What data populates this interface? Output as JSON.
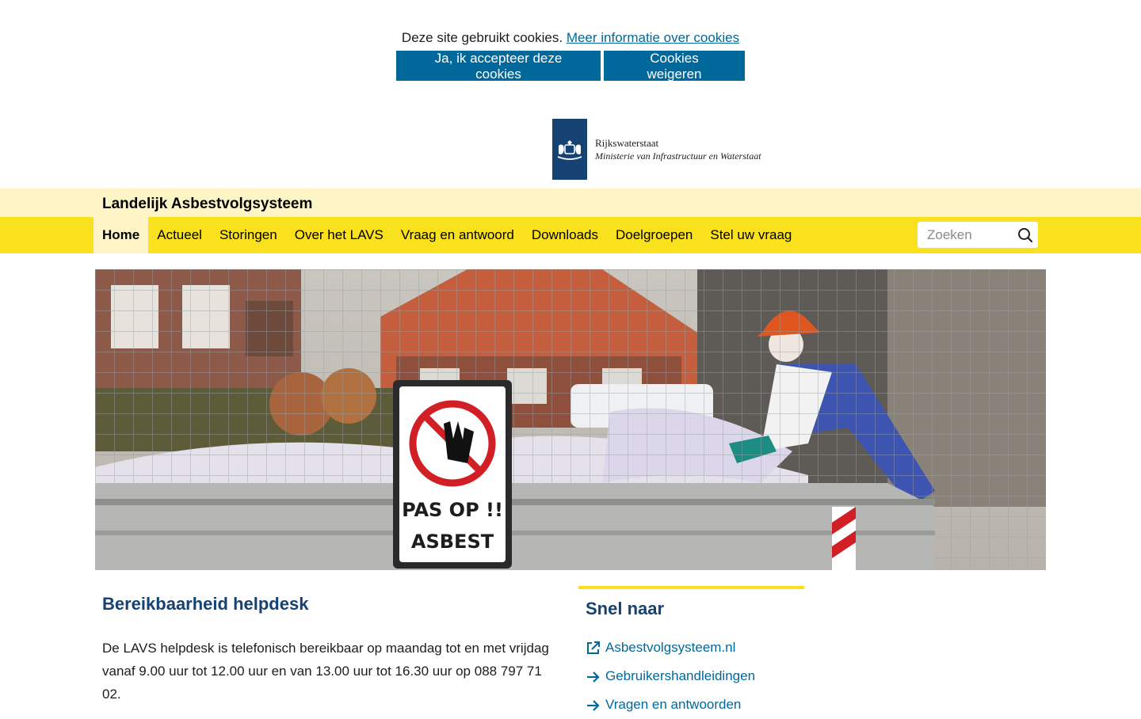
{
  "cookie": {
    "message": "Deze site gebruikt cookies.",
    "more_info_link": "Meer informatie over cookies",
    "accept_label": "Ja, ik accepteer deze cookies",
    "refuse_label": "Cookies weigeren"
  },
  "logo": {
    "org": "Rijkswaterstaat",
    "ministry": "Ministerie van Infrastructuur en Waterstaat"
  },
  "site": {
    "title": "Landelijk Asbestvolgsysteem"
  },
  "nav": {
    "items": [
      {
        "label": "Home",
        "active": true
      },
      {
        "label": "Actueel"
      },
      {
        "label": "Storingen"
      },
      {
        "label": "Over het LAVS"
      },
      {
        "label": "Vraag en antwoord"
      },
      {
        "label": "Downloads"
      },
      {
        "label": "Doelgroepen"
      },
      {
        "label": "Stel uw vraag"
      }
    ],
    "search_placeholder": "Zoeken"
  },
  "hero": {
    "sign_line1": "PAS OP !!",
    "sign_line2": "ASBEST"
  },
  "helpdesk": {
    "heading": "Bereikbaarheid helpdesk",
    "text": "De LAVS helpdesk is telefonisch bereikbaar op maandag tot en met vrijdag vanaf 9.00 uur tot 12.00 uur en van 13.00 uur tot 16.30 uur op 088 797 71 02."
  },
  "quicklinks": {
    "heading": "Snel naar",
    "items": [
      {
        "label": "Asbestvolgsysteem.nl",
        "icon": "external-link-icon"
      },
      {
        "label": "Gebruikershandleidingen",
        "icon": "arrow-right-icon"
      },
      {
        "label": "Vragen en antwoorden",
        "icon": "arrow-right-icon"
      }
    ]
  },
  "colors": {
    "primary_blue": "#01689b",
    "dark_blue": "#154273",
    "yellow": "#f9e11e",
    "light_yellow": "#fff4c6"
  }
}
